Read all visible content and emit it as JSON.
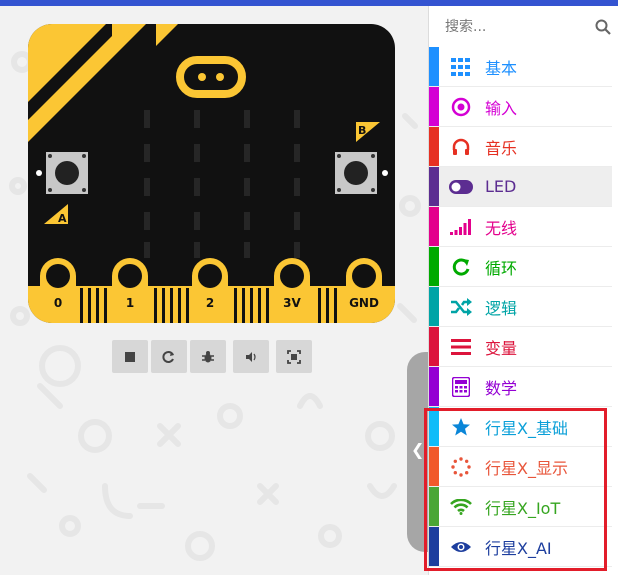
{
  "board": {
    "button_a": "A",
    "button_b": "B",
    "pins": [
      "0",
      "1",
      "2",
      "3V",
      "GND"
    ]
  },
  "simulator_toolbar": {
    "buttons": [
      {
        "name": "stop",
        "icon": "stop-icon"
      },
      {
        "name": "restart",
        "icon": "restart-icon"
      },
      {
        "name": "debug",
        "icon": "bug-icon"
      },
      {
        "name": "mute",
        "icon": "volume-icon"
      },
      {
        "name": "fullscreen",
        "icon": "fullscreen-icon"
      }
    ]
  },
  "toolbox": {
    "search_placeholder": "搜索...",
    "categories": [
      {
        "label": "基本",
        "color": "#1e90ff",
        "icon": "grid-icon"
      },
      {
        "label": "输入",
        "color": "#d400d4",
        "icon": "target-icon"
      },
      {
        "label": "音乐",
        "color": "#e63022",
        "icon": "headphones-icon"
      },
      {
        "label": "LED",
        "color": "#5c2d91",
        "icon": "toggle-icon",
        "selected": true
      },
      {
        "label": "无线",
        "color": "#e3008c",
        "icon": "signal-bars-icon"
      },
      {
        "label": "循环",
        "color": "#00aa00",
        "icon": "refresh-icon"
      },
      {
        "label": "逻辑",
        "color": "#00a4a6",
        "icon": "shuffle-icon"
      },
      {
        "label": "变量",
        "color": "#dc143c",
        "icon": "lines-icon"
      },
      {
        "label": "数学",
        "color": "#9400d3",
        "icon": "calculator-icon"
      },
      {
        "label": "行星X_基础",
        "color": "#0fbcf9",
        "label_color": "#0a9fd8",
        "icon": "star-icon"
      },
      {
        "label": "行星X_显示",
        "color": "#f1592a",
        "label_color": "#e8553a",
        "icon": "dotted-circle-icon"
      },
      {
        "label": "行星X_IoT",
        "color": "#4aa635",
        "label_color": "#36a520",
        "icon": "wifi-icon"
      },
      {
        "label": "行星X_AI",
        "color": "#1d3e9e",
        "label_color": "#1d3e9e",
        "icon": "eye-icon"
      }
    ]
  },
  "colors": {
    "board_black": "#111111",
    "board_gold": "#fbc634",
    "accent_blue": "#3454d1",
    "highlight_red": "#e21d2a"
  }
}
